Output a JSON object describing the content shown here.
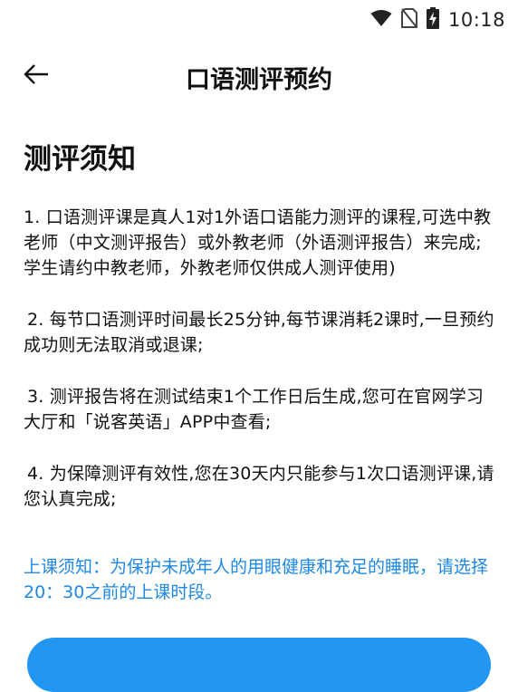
{
  "status_bar": {
    "time": "10:18",
    "icons": [
      "wifi-icon",
      "no-sim-icon",
      "battery-charging-icon"
    ]
  },
  "nav": {
    "back_icon": "arrow-left-icon",
    "title": "口语测评预约"
  },
  "section": {
    "title": "测评须知"
  },
  "notices": [
    "1. 口语测评课是真人1对1外语口语能力测评的课程,可选中教老师（中文测评报告）或外教老师（外语测评报告）来完成;学生请约中教老师，外教老师仅供成人测评使用)",
    "2. 每节口语测评时间最长25分钟,每节课消耗2课时,一旦预约成功则无法取消或退课;",
    "3. 测评报告将在测试结束1个工作日后生成,您可在官网学习大厅和「说客英语」APP中查看;",
    "4. 为保障测评有效性,您在30天内只能参与1次口语测评课,请您认真完成;"
  ],
  "reminder": "上课须知：为保护未成年人的用眼健康和充足的睡眠，请选择20：30之前的上课时段。",
  "colors": {
    "accent": "#2196f3",
    "reminder_text": "#1e88e5"
  }
}
